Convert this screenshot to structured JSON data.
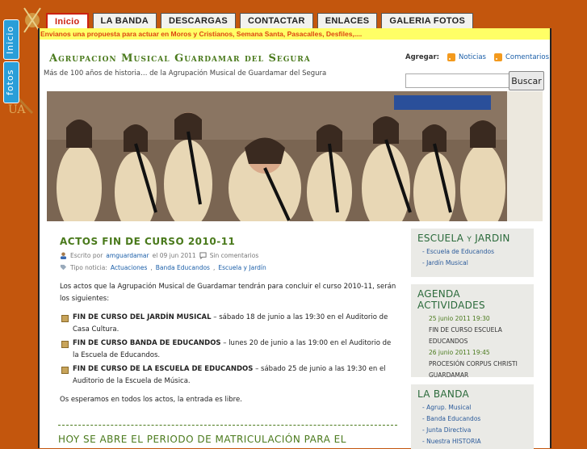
{
  "side_tabs": [
    "Inicio",
    "fotos"
  ],
  "nav": {
    "tabs": [
      {
        "label": "Inicio",
        "active": true
      },
      {
        "label": "LA BANDA",
        "active": false
      },
      {
        "label": "DESCARGAS",
        "active": false
      },
      {
        "label": "CONTACTAR",
        "active": false
      },
      {
        "label": "ENLACES",
        "active": false
      },
      {
        "label": "GALERIA FOTOS",
        "active": false
      }
    ]
  },
  "ticker": "Envianos una propuesta para actuar en Moros y Cristianos, Semana Santa, Pasacalles, Desfiles,....",
  "header": {
    "title": "Agrupacion Musical Guardamar del Segura",
    "description": "Más de 100 años de historia… de la Agrupación Musical de Guardamar del Segura",
    "subscribe_label": "Agregar:",
    "feed_news": "Noticias",
    "feed_comments": "Comentarios",
    "search_button": "Buscar"
  },
  "post": {
    "title": "ACTOS FIN DE CURSO 2010-11",
    "author_prefix": "Escrito por",
    "author": "amguardamar",
    "date": "el 09 jun 2011",
    "comments": "Sin comentarios",
    "type_prefix": "Tipo noticia:",
    "categories": [
      "Actuaciones",
      "Banda Educandos",
      "Escuela y Jardín"
    ],
    "intro": "Los actos que la Agrupación Musical de Guardamar tendrán para concluir el curso 2010-11, serán los siguientes:",
    "items": [
      {
        "bold": "FIN DE CURSO DEL JARDÍN MUSICAL",
        "text": " – sábado 18 de junio a las 19:30 en el Auditorio de Casa Cultura."
      },
      {
        "bold": "FIN DE CURSO BANDA DE EDUCANDOS",
        "text": " – lunes 20 de junio a las 19:00 en el Auditorio de la Escuela de Educandos."
      },
      {
        "bold": "FIN DE CURSO DE LA ESCUELA DE EDUCANDOS",
        "text": " – sábado 25 de junio a las 19:30 en el Auditorio de la Escuela de Música."
      }
    ],
    "outro": "Os esperamos en todos los actos, la entrada es libre."
  },
  "post2_title": "HOY SE ABRE EL PERIODO DE MATRICULACIÓN PARA EL",
  "sidebar": {
    "escuela": {
      "title_main": "ESCUELA",
      "title_small": "Y",
      "title_end": "JARDIN",
      "items": [
        "Escuela de Educandos",
        "Jardín Musical"
      ]
    },
    "agenda": {
      "title": "AGENDA ACTIVIDADES",
      "events": [
        {
          "date": "25 junio 2011 19:30",
          "name": "FIN DE CURSO ESCUELA EDUCANDOS"
        },
        {
          "date": "26 junio 2011 19:45",
          "name": "PROCESIÓN CORPUS CHRISTI GUARDAMAR"
        }
      ]
    },
    "banda": {
      "title": "LA BANDA",
      "items": [
        "Agrup. Musical",
        "Banda Educandos",
        "Junta Directiva",
        "Nuestra HISTORIA"
      ]
    }
  },
  "colors": {
    "background": "#c3560d",
    "accent_green": "#4a7a1c",
    "link_blue": "#1a5ea8",
    "ticker_bg": "#ffff66"
  }
}
